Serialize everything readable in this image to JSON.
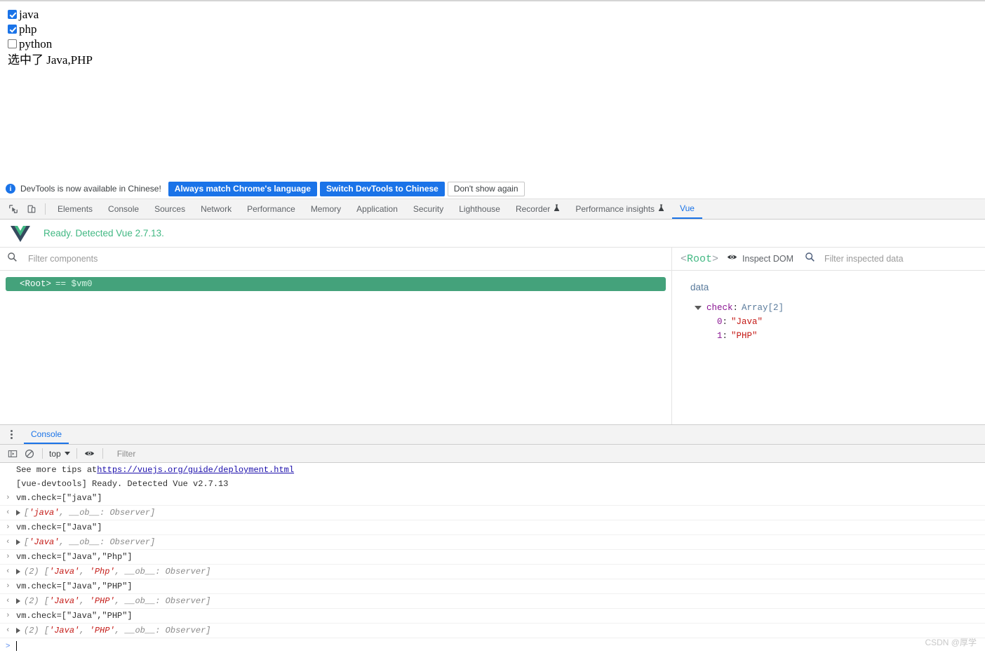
{
  "page": {
    "checkboxes": [
      {
        "label": "java",
        "checked": true
      },
      {
        "label": "php",
        "checked": true
      },
      {
        "label": "python",
        "checked": false
      }
    ],
    "selected_text": "选中了 Java,PHP"
  },
  "notification": {
    "icon": "info-icon",
    "message": "DevTools is now available in Chinese!",
    "primary_button": "Always match Chrome's language",
    "secondary_button": "Switch DevTools to Chinese",
    "dismiss_button": "Don't show again",
    "accent_color": "#1a73e8"
  },
  "devtools": {
    "inspect_icon": "inspect-element-icon",
    "device_icon": "device-toolbar-icon",
    "tabs": [
      {
        "label": "Elements",
        "active": false,
        "experimental": false
      },
      {
        "label": "Console",
        "active": false,
        "experimental": false
      },
      {
        "label": "Sources",
        "active": false,
        "experimental": false
      },
      {
        "label": "Network",
        "active": false,
        "experimental": false
      },
      {
        "label": "Performance",
        "active": false,
        "experimental": false
      },
      {
        "label": "Memory",
        "active": false,
        "experimental": false
      },
      {
        "label": "Application",
        "active": false,
        "experimental": false
      },
      {
        "label": "Security",
        "active": false,
        "experimental": false
      },
      {
        "label": "Lighthouse",
        "active": false,
        "experimental": false
      },
      {
        "label": "Recorder",
        "active": false,
        "experimental": true
      },
      {
        "label": "Performance insights",
        "active": false,
        "experimental": true
      },
      {
        "label": "Vue",
        "active": true,
        "experimental": false
      }
    ],
    "active_tab_color": "#1a73e8"
  },
  "vue_panel": {
    "logo": "vue-logo-icon",
    "ready_text": "Ready. Detected Vue 2.7.13.",
    "ready_color": "#42b883",
    "components": {
      "search_icon": "search-icon",
      "filter_placeholder": "Filter components",
      "filter_value": "",
      "selected_row": {
        "name": "<Root>",
        "vm": "== $vm0",
        "background": "#44a27b"
      }
    },
    "inspector": {
      "title": "<Root>",
      "eye_icon": "eye-icon",
      "inspect_dom_label": "Inspect DOM",
      "search_icon": "search-icon",
      "filter_placeholder": "Filter inspected data",
      "filter_value": "",
      "section_label": "data",
      "entries": [
        {
          "key": "check",
          "type": "Array[2]",
          "expanded": true,
          "children": [
            {
              "index": "0",
              "value": "\"Java\""
            },
            {
              "index": "1",
              "value": "\"PHP\""
            }
          ]
        }
      ]
    }
  },
  "console_drawer": {
    "kebab_icon": "more-options-icon",
    "tab_label": "Console",
    "toolbar": {
      "sidebar_icon": "console-sidebar-icon",
      "clear_icon": "clear-console-icon",
      "context_value": "top",
      "eye_icon": "live-expression-icon",
      "filter_placeholder": "Filter",
      "filter_value": ""
    },
    "messages": [
      {
        "kind": "plain",
        "prefix": "See more tips at ",
        "link": "https://vuejs.org/guide/deployment.html"
      },
      {
        "kind": "plain",
        "text": "[vue-devtools] Ready. Detected Vue v2.7.13"
      },
      {
        "kind": "input",
        "text": "vm.check=[\"java\"]"
      },
      {
        "kind": "output",
        "count": "",
        "items": [
          "'java'"
        ],
        "tail": "__ob__: Observer"
      },
      {
        "kind": "input",
        "text": "vm.check=[\"Java\"]"
      },
      {
        "kind": "output",
        "count": "",
        "items": [
          "'Java'"
        ],
        "tail": "__ob__: Observer"
      },
      {
        "kind": "input",
        "text": "vm.check=[\"Java\",\"Php\"]"
      },
      {
        "kind": "output",
        "count": "(2)",
        "items": [
          "'Java'",
          "'Php'"
        ],
        "tail": "__ob__: Observer"
      },
      {
        "kind": "input",
        "text": "vm.check=[\"Java\",\"PHP\"]"
      },
      {
        "kind": "output",
        "count": "(2)",
        "items": [
          "'Java'",
          "'PHP'"
        ],
        "tail": "__ob__: Observer"
      },
      {
        "kind": "input",
        "text": "vm.check=[\"Java\",\"PHP\"]"
      },
      {
        "kind": "output",
        "count": "(2)",
        "items": [
          "'Java'",
          "'PHP'"
        ],
        "tail": "__ob__: Observer"
      }
    ],
    "prompt_symbol": ">",
    "prompt_value": ""
  },
  "watermark": "CSDN @厚学"
}
